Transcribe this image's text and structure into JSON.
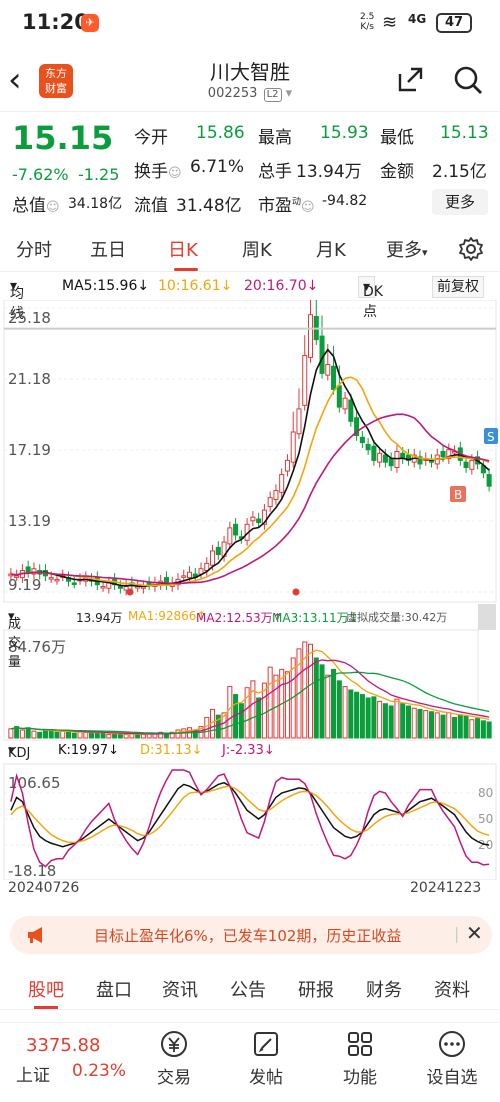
{
  "status": {
    "time": "11:20",
    "net_speed": "2.5",
    "net_unit": "K/s",
    "signal": "4G",
    "battery": "47"
  },
  "header": {
    "title": "川大智胜",
    "code": "002253",
    "level": "L2",
    "logo_line1": "东方",
    "logo_line2": "财富"
  },
  "quote": {
    "price": "15.15",
    "change_pct": "-7.62%",
    "change": "-1.25",
    "open_label": "今开",
    "open": "15.86",
    "high_label": "最高",
    "high": "15.93",
    "low_label": "最低",
    "low": "15.13",
    "turnover_label": "换手",
    "turnover": "6.71%",
    "volume_label": "总手",
    "volume": "13.94万",
    "amount_label": "金额",
    "amount": "2.15亿",
    "mcap_label": "总值",
    "mcap": "34.18亿",
    "float_label": "流值",
    "float": "31.48亿",
    "pe_label": "市盈",
    "pe_sup": "动",
    "pe": "-94.82",
    "more": "更多"
  },
  "tabs": [
    "分时",
    "五日",
    "日K",
    "周K",
    "月K",
    "更多"
  ],
  "chart_toolbar": {
    "ma": "均线",
    "ma5": "MA5:15.96↓",
    "ma10": "10:16.61↓",
    "ma20": "20:16.70↓",
    "dk": "DK点",
    "fq": "前复权"
  },
  "chart_data": [
    {
      "type": "candlestick",
      "title": "",
      "y_ticks": [
        "25.18",
        "21.18",
        "17.19",
        "13.19",
        "9.19"
      ],
      "ylim": [
        9.19,
        25.18
      ],
      "marker_labels": [
        "S",
        "B"
      ],
      "series_colors": {
        "up": "#e03a3a",
        "down": "#0a9d3c",
        "ma5": "#111111",
        "ma10": "#f2a60c",
        "ma20": "#c2177a"
      },
      "close": [
        10.2,
        10.1,
        10.4,
        10.3,
        10.5,
        10.2,
        10.1,
        10.0,
        9.9,
        10.1,
        9.8,
        9.7,
        9.9,
        10.0,
        9.8,
        9.6,
        9.5,
        9.7,
        9.6,
        9.4,
        9.5,
        9.6,
        9.5,
        9.5,
        9.6,
        9.7,
        9.8,
        9.6,
        9.7,
        9.9,
        10.1,
        10.3,
        10.0,
        10.5,
        10.8,
        11.5,
        11.3,
        12.0,
        12.8,
        12.4,
        12.2,
        13.0,
        13.4,
        13.1,
        13.8,
        14.5,
        14.9,
        15.8,
        16.6,
        18.2,
        19.5,
        22.5,
        24.8,
        23.4,
        21.5,
        22.0,
        20.6,
        19.6,
        20.1,
        18.8,
        18.0,
        17.6,
        17.2,
        16.6,
        17.0,
        16.5,
        16.3,
        17.1,
        16.7,
        16.6,
        16.9,
        16.4,
        16.7,
        16.5,
        16.9,
        16.8,
        17.2,
        17.1,
        16.6,
        16.2,
        16.6,
        16.4,
        15.9,
        15.15
      ]
    },
    {
      "type": "bar",
      "title": "成交量",
      "y_ticks": [
        "84.76万"
      ],
      "values": [
        8,
        10,
        7,
        9,
        6,
        5,
        7,
        6,
        5,
        6,
        5,
        4,
        6,
        5,
        4,
        5,
        4,
        3,
        4,
        3,
        3,
        4,
        3,
        3,
        4,
        4,
        5,
        4,
        5,
        7,
        8,
        9,
        7,
        10,
        18,
        25,
        20,
        22,
        45,
        38,
        30,
        44,
        50,
        35,
        48,
        62,
        55,
        60,
        58,
        70,
        78,
        84,
        82,
        70,
        64,
        55,
        60,
        50,
        45,
        42,
        40,
        38,
        35,
        36,
        32,
        30,
        28,
        34,
        30,
        28,
        26,
        25,
        24,
        23,
        22,
        20,
        22,
        18,
        20,
        19,
        16,
        17,
        15,
        14
      ],
      "legend": [
        "13.94万",
        "MA1:92866↑",
        "MA2:12.53万↑",
        "MA3:13.11万↓",
        "虚拟成交量:30.42万"
      ]
    },
    {
      "type": "line",
      "title": "KDJ",
      "y_ticks": [
        "106.65",
        "-18.18"
      ],
      "right_ticks": [
        "80",
        "50",
        "20"
      ],
      "x_ticks": [
        "20240726",
        "20241223"
      ],
      "series": [
        {
          "name": "K:19.97↓",
          "values": [
            60,
            75,
            70,
            55,
            40,
            30,
            25,
            22,
            20,
            18,
            20,
            22,
            25,
            30,
            35,
            40,
            45,
            50,
            45,
            40,
            35,
            30,
            25,
            28,
            35,
            45,
            55,
            65,
            75,
            85,
            90,
            88,
            84,
            80,
            82,
            86,
            90,
            92,
            88,
            80,
            70,
            60,
            55,
            50,
            55,
            65,
            75,
            80,
            82,
            84,
            86,
            85,
            80,
            70,
            60,
            50,
            40,
            35,
            30,
            28,
            30,
            35,
            45,
            55,
            60,
            62,
            60,
            58,
            55,
            60,
            65,
            70,
            72,
            74,
            70,
            65,
            60,
            55,
            45,
            35,
            28,
            24,
            21,
            19.97
          ]
        },
        {
          "name": "D:31.13↓",
          "values": [
            55,
            62,
            65,
            60,
            52,
            45,
            38,
            32,
            28,
            25,
            23,
            23,
            24,
            26,
            29,
            33,
            37,
            41,
            43,
            42,
            40,
            37,
            33,
            31,
            32,
            36,
            42,
            50,
            58,
            67,
            75,
            80,
            81,
            81,
            81,
            83,
            85,
            87,
            88,
            85,
            80,
            73,
            67,
            61,
            59,
            61,
            66,
            71,
            75,
            78,
            81,
            82,
            81,
            77,
            71,
            64,
            56,
            49,
            43,
            38,
            35,
            35,
            38,
            44,
            49,
            53,
            55,
            56,
            56,
            57,
            60,
            63,
            66,
            69,
            70,
            68,
            65,
            62,
            56,
            49,
            42,
            36,
            33,
            31.13
          ]
        },
        {
          "name": "J:-2.33↓",
          "values": [
            70,
            100,
            80,
            45,
            15,
            0,
            -5,
            2,
            4,
            4,
            14,
            20,
            27,
            38,
            47,
            54,
            61,
            68,
            49,
            36,
            25,
            16,
            9,
            22,
            41,
            63,
            81,
            95,
            109,
            121,
            120,
            104,
            90,
            78,
            84,
            92,
            100,
            102,
            88,
            70,
            50,
            34,
            31,
            28,
            47,
            73,
            93,
            98,
            96,
            96,
            96,
            91,
            78,
            56,
            38,
            22,
            8,
            7,
            4,
            8,
            20,
            35,
            59,
            77,
            82,
            80,
            70,
            62,
            53,
            66,
            75,
            84,
            84,
            84,
            70,
            59,
            50,
            41,
            23,
            7,
            0,
            0,
            -3,
            -2.33
          ]
        }
      ]
    }
  ],
  "promo": {
    "text": "目标止盈年化6%，已发车102期，历史正收益"
  },
  "subtabs": [
    "股吧",
    "盘口",
    "资讯",
    "公告",
    "研报",
    "财务",
    "资料"
  ],
  "bottom_nav": {
    "index_value": "3375.88",
    "index_name": "上证",
    "index_pct": "0.23%",
    "items": [
      "交易",
      "发帖",
      "功能",
      "设自选"
    ]
  }
}
